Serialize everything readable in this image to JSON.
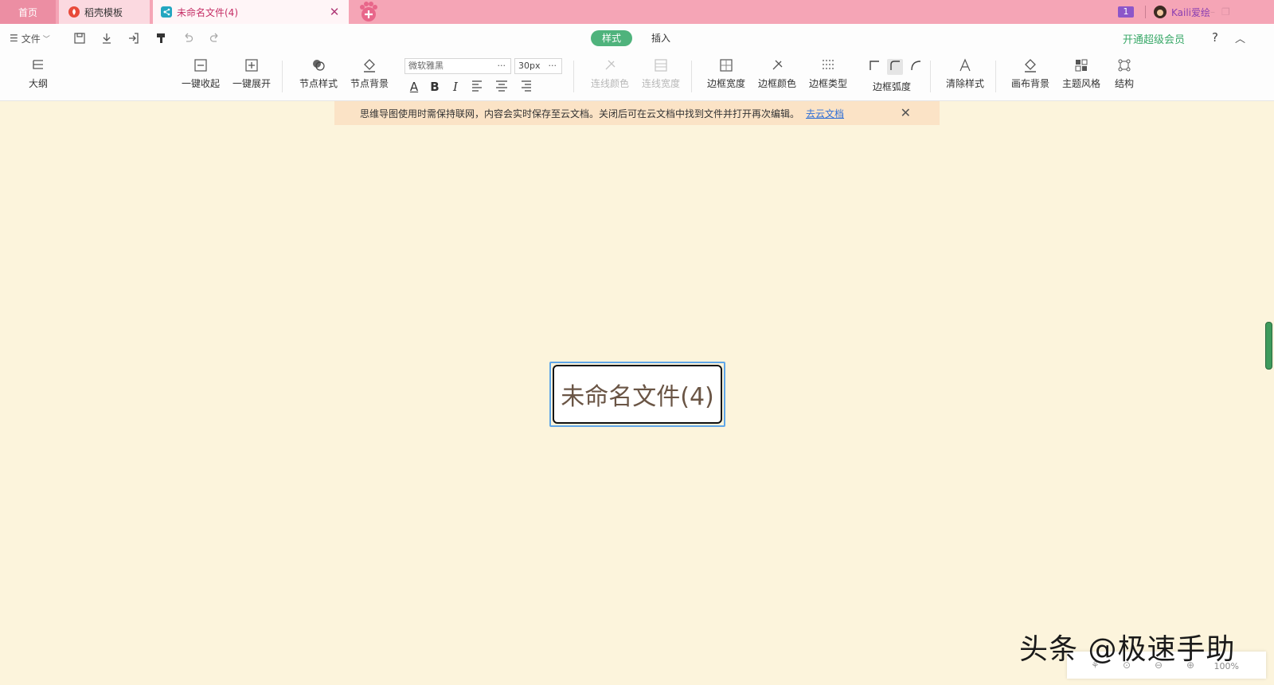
{
  "tabs": {
    "home": "首页",
    "daoke": "稻壳模板",
    "file": "未命名文件(4)",
    "badge": "1",
    "username": "Kaili爱绘"
  },
  "menu": {
    "file": "文件",
    "mode_style": "样式",
    "mode_insert": "插入",
    "vip": "开通超级会员",
    "help": "?"
  },
  "ribbon": {
    "outline": "大纲",
    "collapse_all": "一键收起",
    "expand_all": "一键展开",
    "node_style": "节点样式",
    "node_bg": "节点背景",
    "font": "微软雅黑",
    "font_size": "30px",
    "line_color": "连线颜色",
    "line_width": "连线宽度",
    "border_width": "边框宽度",
    "border_color": "边框颜色",
    "border_type": "边框类型",
    "border_radius": "边框弧度",
    "clear_style": "清除样式",
    "canvas_bg": "画布背景",
    "theme": "主题风格",
    "structure": "结构",
    "bold": "B",
    "italic": "I",
    "font_color": "A"
  },
  "notice": {
    "text": "思维导图使用时需保持联网，内容会实时保存至云文档。关闭后可在云文档中找到文件并打开再次编辑。",
    "link": "去云文档"
  },
  "canvas": {
    "root_node": "未命名文件(4)"
  },
  "footer": {
    "zoom": "100%",
    "watermark": "头条 @极速手助"
  },
  "colors": {
    "tabbar": "#f5a5b6",
    "canvas_bg": "#fcf4dc",
    "accent_green": "#4fb37c",
    "notice_bg": "#fbe3c6"
  }
}
